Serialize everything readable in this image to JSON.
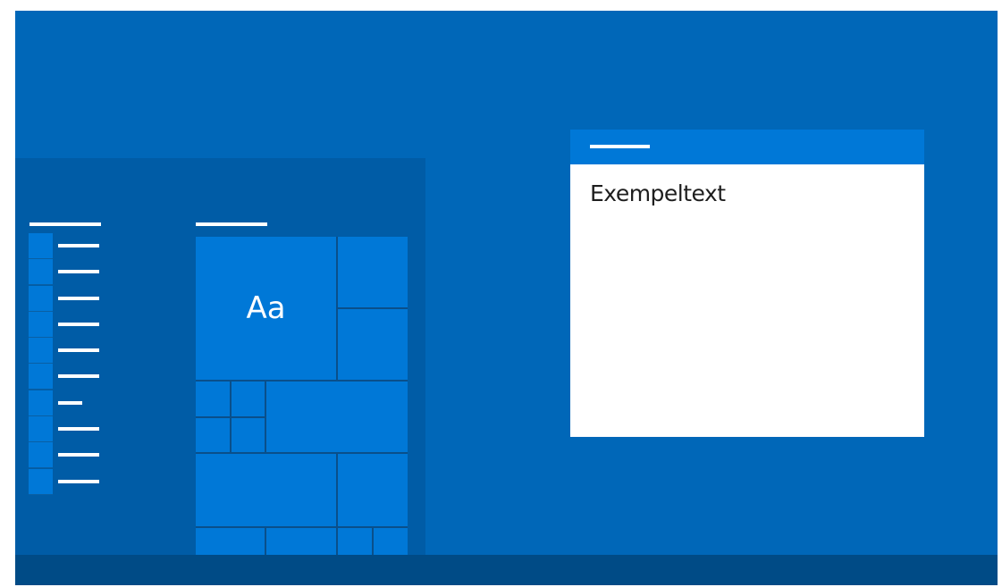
{
  "colors": {
    "desktop": "#0067b8",
    "taskbar": "#004b86",
    "start_menu": "#005ca6",
    "tile": "#0078d7",
    "window_titlebar": "#0078d7",
    "window_body": "#ffffff",
    "text_dark": "#1e1e1e"
  },
  "start_menu": {
    "large_tile_text": "Aa"
  },
  "window": {
    "sample_text": "Exempeltext"
  }
}
